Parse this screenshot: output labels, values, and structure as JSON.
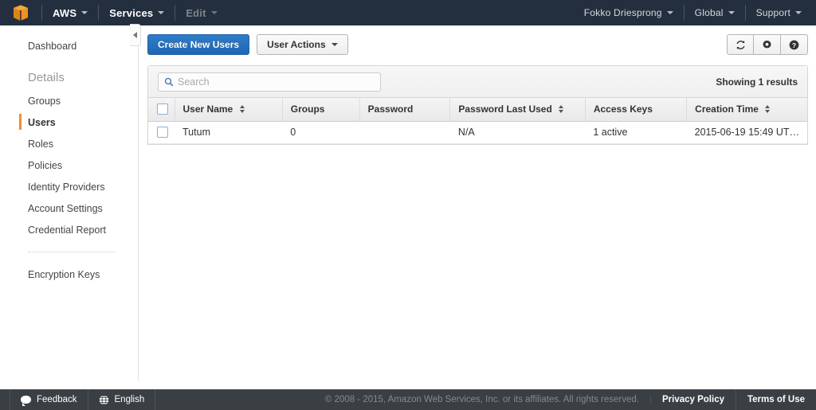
{
  "topnav": {
    "logo_icon": "aws-cube-logo",
    "items": [
      {
        "label": "AWS",
        "dim": false
      },
      {
        "label": "Services",
        "dim": false
      },
      {
        "label": "Edit",
        "dim": true
      }
    ],
    "right_items": [
      {
        "label": "Fokko Driesprong"
      },
      {
        "label": "Global"
      },
      {
        "label": "Support"
      }
    ]
  },
  "sidebar": {
    "items": [
      {
        "label": "Dashboard",
        "type": "link",
        "active": false
      },
      {
        "label": "Details",
        "type": "header",
        "active": false
      },
      {
        "label": "Groups",
        "type": "link",
        "active": false
      },
      {
        "label": "Users",
        "type": "link",
        "active": true
      },
      {
        "label": "Roles",
        "type": "link",
        "active": false
      },
      {
        "label": "Policies",
        "type": "link",
        "active": false
      },
      {
        "label": "Identity Providers",
        "type": "link",
        "active": false
      },
      {
        "label": "Account Settings",
        "type": "link",
        "active": false
      },
      {
        "label": "Credential Report",
        "type": "link",
        "active": false
      }
    ],
    "after_divider": [
      {
        "label": "Encryption Keys",
        "type": "link",
        "active": false
      }
    ],
    "collapse_icon": "chevron-left-icon"
  },
  "toolbar": {
    "create_label": "Create New Users",
    "actions_label": "User Actions",
    "refresh_icon": "refresh-icon",
    "settings_icon": "gear-icon",
    "help_icon": "help-icon"
  },
  "search": {
    "placeholder": "Search",
    "value": "",
    "icon": "search-icon"
  },
  "results_text": "Showing 1 results",
  "table": {
    "columns": [
      {
        "label": "User Name",
        "sortable": true
      },
      {
        "label": "Groups",
        "sortable": false
      },
      {
        "label": "Password",
        "sortable": false
      },
      {
        "label": "Password Last Used",
        "sortable": true
      },
      {
        "label": "Access Keys",
        "sortable": false
      },
      {
        "label": "Creation Time",
        "sortable": true
      }
    ],
    "rows": [
      {
        "user_name": "Tutum",
        "groups": "0",
        "password": "",
        "password_last_used": "N/A",
        "access_keys": "1 active",
        "creation_time": "2015-06-19 15:49 UT…"
      }
    ]
  },
  "footer": {
    "feedback_label": "Feedback",
    "language_label": "English",
    "copyright": "© 2008 - 2015, Amazon Web Services, Inc. or its affiliates. All rights reserved.",
    "privacy_label": "Privacy Policy",
    "terms_label": "Terms of Use"
  },
  "colors": {
    "nav_bg": "#232f3e",
    "accent_orange": "#ec912d",
    "primary_blue": "#2f7dc9",
    "footer_bg": "#3a3f44"
  }
}
